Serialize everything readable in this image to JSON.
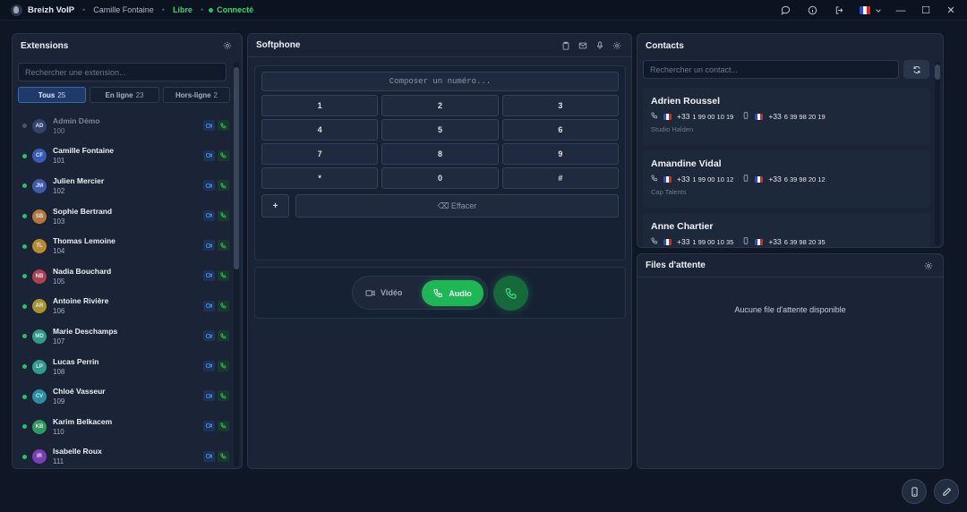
{
  "titlebar": {
    "app_name": "Breizh VoIP",
    "user": "Camille Fontaine",
    "status": "Libre",
    "connection": "Connecté",
    "sep": "•"
  },
  "extensions": {
    "title": "Extensions",
    "search_placeholder": "Rechercher une extension...",
    "filters": [
      {
        "label": "Tous",
        "count": "25"
      },
      {
        "label": "En ligne",
        "count": "23"
      },
      {
        "label": "Hors-ligne",
        "count": "2"
      }
    ],
    "items": [
      {
        "initials": "AD",
        "name": "Admin Démo",
        "number": "100",
        "online": false,
        "color": "#34436a"
      },
      {
        "initials": "CF",
        "name": "Camille Fontaine",
        "number": "101",
        "online": true,
        "color": "#3a5bb5"
      },
      {
        "initials": "JM",
        "name": "Julien Mercier",
        "number": "102",
        "online": true,
        "color": "#3f5aa8"
      },
      {
        "initials": "SB",
        "name": "Sophie Bertrand",
        "number": "103",
        "online": true,
        "color": "#b5773a"
      },
      {
        "initials": "TL",
        "name": "Thomas Lemoine",
        "number": "104",
        "online": true,
        "color": "#b88a2f"
      },
      {
        "initials": "NB",
        "name": "Nadia Bouchard",
        "number": "105",
        "online": true,
        "color": "#b1404f"
      },
      {
        "initials": "AR",
        "name": "Antoine Rivière",
        "number": "106",
        "online": true,
        "color": "#a8942d"
      },
      {
        "initials": "MD",
        "name": "Marie Deschamps",
        "number": "107",
        "online": true,
        "color": "#2f9a86"
      },
      {
        "initials": "LP",
        "name": "Lucas Perrin",
        "number": "108",
        "online": true,
        "color": "#2f9c8f"
      },
      {
        "initials": "CV",
        "name": "Chloé Vasseur",
        "number": "109",
        "online": true,
        "color": "#2a8ea0"
      },
      {
        "initials": "KB",
        "name": "Karim Belkacem",
        "number": "110",
        "online": true,
        "color": "#2f9a5f"
      },
      {
        "initials": "IR",
        "name": "Isabelle Roux",
        "number": "111",
        "online": true,
        "color": "#7a3fb0"
      }
    ]
  },
  "softphone": {
    "title": "Softphone",
    "dial_placeholder": "Composer un numéro...",
    "keys": [
      "1",
      "2",
      "3",
      "4",
      "5",
      "6",
      "7",
      "8",
      "9",
      "*",
      "0",
      "#"
    ],
    "plus_label": "+",
    "clear_label": "⌫ Effacer",
    "video_label": "Vidéo",
    "audio_label": "Audio"
  },
  "contacts": {
    "title": "Contacts",
    "search_placeholder": "Rechercher un contact...",
    "items": [
      {
        "name": "Adrien Roussel",
        "phone1_prefix": "+33",
        "phone1": "1 99 00 10 19",
        "phone2_prefix": "+33",
        "phone2": "6 39 98 20 19",
        "company": "Studio Halden"
      },
      {
        "name": "Amandine Vidal",
        "phone1_prefix": "+33",
        "phone1": "1 99 00 10 12",
        "phone2_prefix": "+33",
        "phone2": "6 39 98 20 12",
        "company": "Cap Talents"
      },
      {
        "name": "Anne Chartier",
        "phone1_prefix": "+33",
        "phone1": "1 99 00 10 35",
        "phone2_prefix": "+33",
        "phone2": "6 39 98 20 35",
        "company": ""
      }
    ]
  },
  "queues": {
    "title": "Files d'attente",
    "empty": "Aucune file d'attente disponible"
  },
  "window": {
    "minimize": "—",
    "maximize": "☐",
    "close": "✕"
  }
}
